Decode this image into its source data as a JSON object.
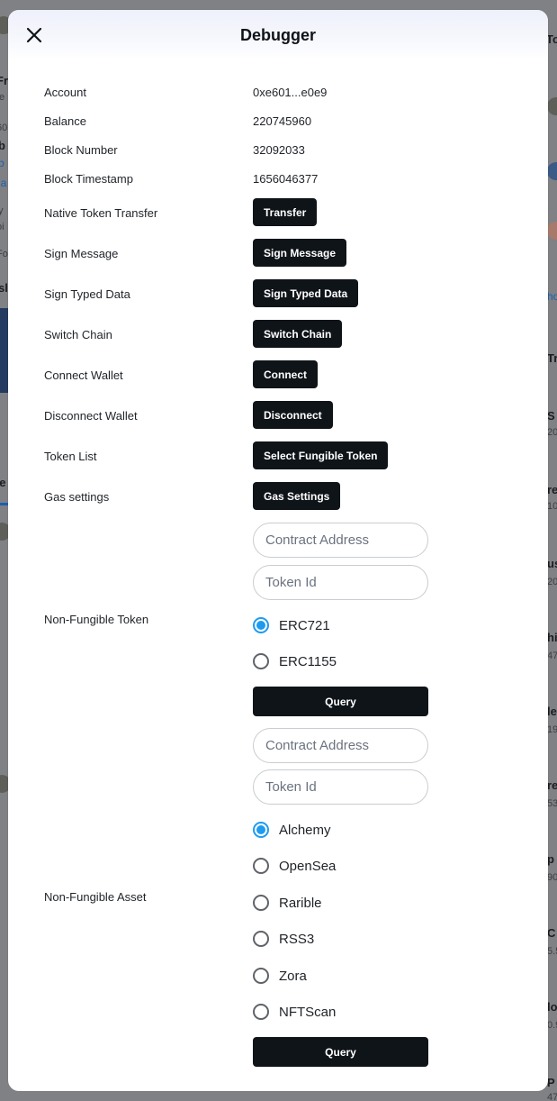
{
  "background": {
    "left_fragments": [
      "Fr",
      "fe",
      "60",
      "b",
      "b",
      "la",
      "y",
      "oi",
      "Fo",
      "sl",
      "ve"
    ],
    "right_fragments": [
      "To",
      "ho",
      "Tr",
      "S",
      "20",
      "re",
      "10",
      "us",
      "20",
      "hi",
      "47",
      "le",
      "19",
      "re",
      "53",
      "p",
      "90",
      "C",
      "5.5",
      "lo",
      "0.9",
      "P",
      "47"
    ]
  },
  "modal": {
    "title": "Debugger",
    "close_icon": "close-icon"
  },
  "account": {
    "label": "Account",
    "value": "0xe601...e0e9"
  },
  "balance": {
    "label": "Balance",
    "value": "220745960"
  },
  "block_number": {
    "label": "Block Number",
    "value": "32092033"
  },
  "block_timestamp": {
    "label": "Block Timestamp",
    "value": "1656046377"
  },
  "native_transfer": {
    "label": "Native Token Transfer",
    "button": "Transfer"
  },
  "sign_message": {
    "label": "Sign Message",
    "button": "Sign Message"
  },
  "sign_typed_data": {
    "label": "Sign Typed Data",
    "button": "Sign Typed Data"
  },
  "switch_chain": {
    "label": "Switch Chain",
    "button": "Switch Chain"
  },
  "connect_wallet": {
    "label": "Connect Wallet",
    "button": "Connect"
  },
  "disconnect_wallet": {
    "label": "Disconnect Wallet",
    "button": "Disconnect"
  },
  "token_list": {
    "label": "Token List",
    "button": "Select Fungible Token"
  },
  "gas_settings": {
    "label": "Gas settings",
    "button": "Gas Settings"
  },
  "non_fungible_token": {
    "label": "Non-Fungible Token",
    "contract_placeholder": "Contract Address",
    "token_id_placeholder": "Token Id",
    "options": [
      {
        "label": "ERC721",
        "checked": true
      },
      {
        "label": "ERC1155",
        "checked": false
      }
    ],
    "query_button": "Query"
  },
  "non_fungible_asset": {
    "label": "Non-Fungible Asset",
    "contract_placeholder": "Contract Address",
    "token_id_placeholder": "Token Id",
    "options": [
      {
        "label": "Alchemy",
        "checked": true
      },
      {
        "label": "OpenSea",
        "checked": false
      },
      {
        "label": "Rarible",
        "checked": false
      },
      {
        "label": "RSS3",
        "checked": false
      },
      {
        "label": "Zora",
        "checked": false
      },
      {
        "label": "NFTScan",
        "checked": false
      }
    ],
    "query_button": "Query"
  },
  "colors": {
    "accent": "#1d9bf0",
    "button_bg": "#0f1419",
    "overlay": "#7f8184"
  }
}
